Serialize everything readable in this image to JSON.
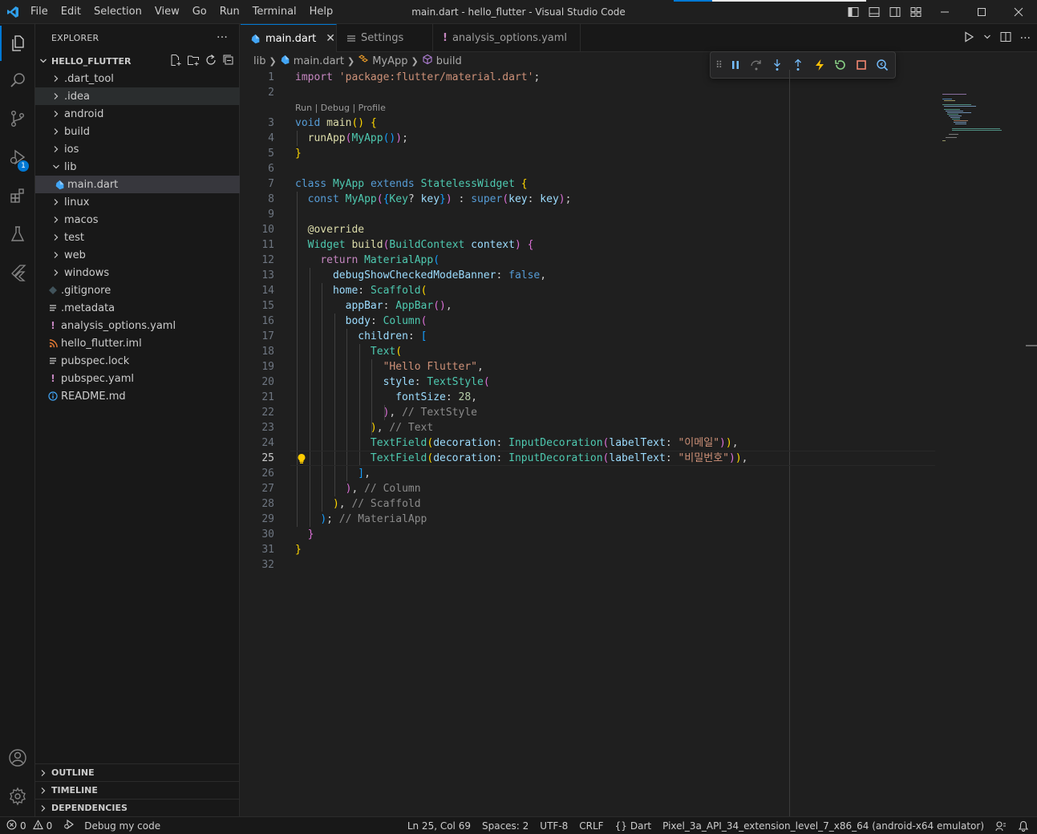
{
  "titlebar": {
    "menu": [
      "File",
      "Edit",
      "Selection",
      "View",
      "Go",
      "Run",
      "Terminal",
      "Help"
    ],
    "window_title": "main.dart - hello_flutter - Visual Studio Code"
  },
  "activity": {
    "debug_badge": "1"
  },
  "sidebar": {
    "title": "EXPLORER",
    "more": "···",
    "project": "HELLO_FLUTTER",
    "items": [
      {
        "label": ".dart_tool",
        "type": "folder"
      },
      {
        "label": ".idea",
        "type": "folder"
      },
      {
        "label": "android",
        "type": "folder"
      },
      {
        "label": "build",
        "type": "folder"
      },
      {
        "label": "ios",
        "type": "folder"
      },
      {
        "label": "lib",
        "type": "folder-open"
      },
      {
        "label": "main.dart",
        "type": "dart"
      },
      {
        "label": "linux",
        "type": "folder"
      },
      {
        "label": "macos",
        "type": "folder"
      },
      {
        "label": "test",
        "type": "folder"
      },
      {
        "label": "web",
        "type": "folder"
      },
      {
        "label": "windows",
        "type": "folder"
      },
      {
        "label": ".gitignore",
        "type": "git"
      },
      {
        "label": ".metadata",
        "type": "lines"
      },
      {
        "label": "analysis_options.yaml",
        "type": "yaml"
      },
      {
        "label": "hello_flutter.iml",
        "type": "rss"
      },
      {
        "label": "pubspec.lock",
        "type": "lines"
      },
      {
        "label": "pubspec.yaml",
        "type": "yaml"
      },
      {
        "label": "README.md",
        "type": "info"
      }
    ],
    "bottom_sections": [
      "OUTLINE",
      "TIMELINE",
      "DEPENDENCIES"
    ]
  },
  "tabs": [
    {
      "label": "main.dart",
      "active": true
    },
    {
      "label": "Settings",
      "active": false
    },
    {
      "label": "analysis_options.yaml",
      "active": false
    }
  ],
  "breadcrumb": {
    "folder": "lib",
    "file": "main.dart",
    "class": "MyApp",
    "method": "build"
  },
  "codelens": "Run | Debug | Profile",
  "line_numbers": [
    "1",
    "2",
    "3",
    "4",
    "5",
    "6",
    "7",
    "8",
    "9",
    "10",
    "11",
    "12",
    "13",
    "14",
    "15",
    "16",
    "17",
    "18",
    "19",
    "20",
    "21",
    "22",
    "23",
    "24",
    "25",
    "26",
    "27",
    "28",
    "29",
    "30",
    "31",
    "32"
  ],
  "current_line": "25",
  "code": {
    "l1": [
      "import",
      "'package:flutter/material.dart'",
      ";"
    ],
    "l3": [
      "void",
      "main",
      "()",
      "{"
    ],
    "l4": [
      "runApp",
      "(",
      "MyApp",
      "()",
      ")",
      ";"
    ],
    "l5": [
      "}"
    ],
    "l7": [
      "class",
      "MyApp",
      "extends",
      "StatelessWidget",
      "{"
    ],
    "l8": [
      "const",
      "MyApp",
      "(",
      "{",
      "Key",
      "?",
      "key",
      "}",
      ")",
      " : ",
      "super",
      "(",
      "key",
      ": ",
      "key",
      ")",
      ";"
    ],
    "l10": [
      "@override"
    ],
    "l11": [
      "Widget",
      "build",
      "(",
      "BuildContext",
      "context",
      ")",
      "{"
    ],
    "l12": [
      "return",
      "MaterialApp",
      "("
    ],
    "l13": [
      "debugShowCheckedModeBanner",
      ": ",
      "false",
      ","
    ],
    "l14": [
      "home",
      ": ",
      "Scaffold",
      "("
    ],
    "l15": [
      "appBar",
      ": ",
      "AppBar",
      "()",
      ","
    ],
    "l16": [
      "body",
      ": ",
      "Column",
      "("
    ],
    "l17": [
      "children",
      ": ",
      "["
    ],
    "l18": [
      "Text",
      "("
    ],
    "l19": [
      "\"Hello Flutter\"",
      ","
    ],
    "l20": [
      "style",
      ": ",
      "TextStyle",
      "("
    ],
    "l21": [
      "fontSize",
      ": ",
      "28",
      ","
    ],
    "l22": [
      ")",
      ", ",
      "// TextStyle"
    ],
    "l23": [
      ")",
      ", ",
      "// Text"
    ],
    "l24": [
      "TextField",
      "(",
      "decoration",
      ": ",
      "InputDecoration",
      "(",
      "labelText",
      ": ",
      "\"이메일\"",
      ")",
      ")",
      ","
    ],
    "l25": [
      "TextField",
      "(",
      "decoration",
      ": ",
      "InputDecoration",
      "(",
      "labelText",
      ": ",
      "\"비밀번호\"",
      ")",
      ")",
      ","
    ],
    "l26": [
      "]",
      ","
    ],
    "l27": [
      ")",
      ", ",
      "// Column"
    ],
    "l28": [
      ")",
      ", ",
      "// Scaffold"
    ],
    "l29": [
      ")",
      "; ",
      "// MaterialApp"
    ],
    "l30": [
      "}"
    ],
    "l31": [
      "}"
    ]
  },
  "status": {
    "errors": "0",
    "warnings": "0",
    "debug": "Debug my code",
    "position": "Ln 25, Col 69",
    "spaces": "Spaces: 2",
    "encoding": "UTF-8",
    "eol": "CRLF",
    "language": "Dart",
    "device": "Pixel_3a_API_34_extension_level_7_x86_64 (android-x64 emulator)"
  },
  "colors": {
    "accent": "#0078d4",
    "dart": "#42a5f5",
    "yaml": "#c586c0",
    "rss": "#e37933"
  }
}
